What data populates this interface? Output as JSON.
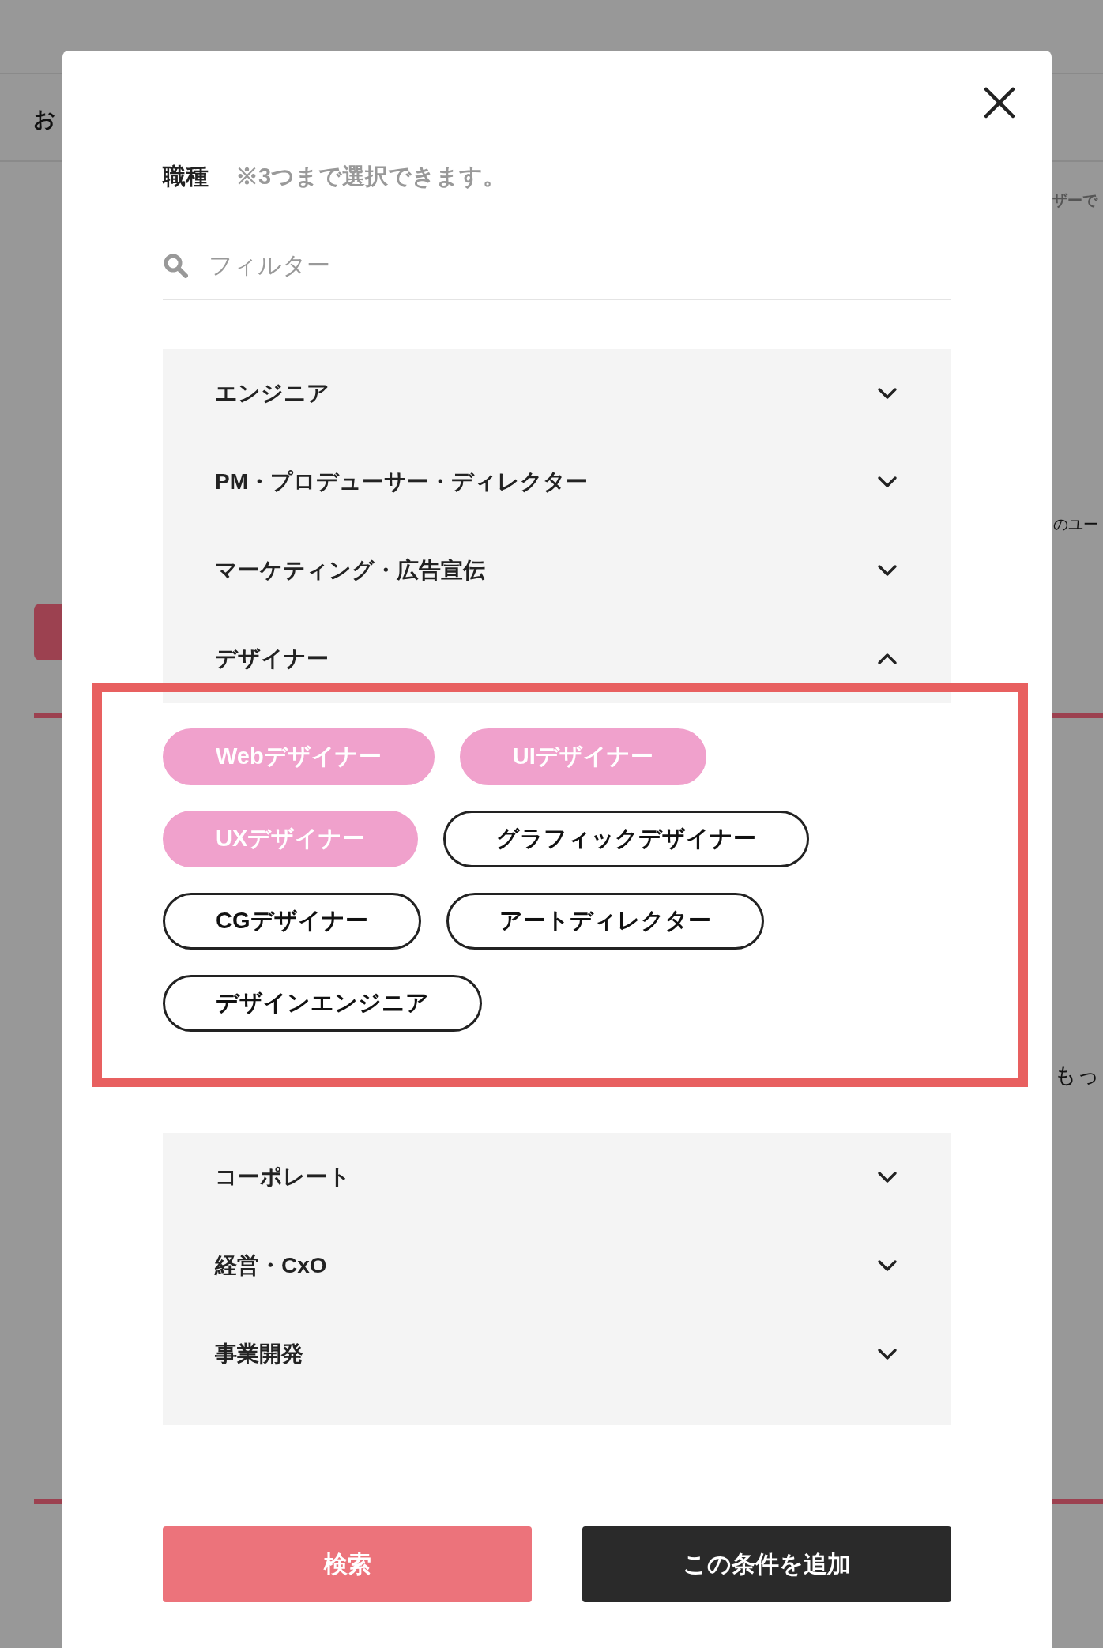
{
  "background": {
    "fragments": [
      "お",
      "ザーで",
      "のユー",
      "もっ"
    ]
  },
  "dialog": {
    "title": "職種",
    "note": "※3つまで選択できます。",
    "search": {
      "placeholder": "フィルター"
    },
    "sections": [
      {
        "label": "エンジニア",
        "expanded": false,
        "highlighted": false
      },
      {
        "label": "PM・プロデューサー・ディレクター",
        "expanded": false,
        "highlighted": false
      },
      {
        "label": "マーケティング・広告宣伝",
        "expanded": false,
        "highlighted": false
      },
      {
        "label": "デザイナー",
        "expanded": true,
        "highlighted": true,
        "options": [
          {
            "label": "Webデザイナー",
            "selected": true
          },
          {
            "label": "UIデザイナー",
            "selected": true
          },
          {
            "label": "UXデザイナー",
            "selected": true
          },
          {
            "label": "グラフィックデザイナー",
            "selected": false
          },
          {
            "label": "CGデザイナー",
            "selected": false
          },
          {
            "label": "アートディレクター",
            "selected": false
          },
          {
            "label": "デザインエンジニア",
            "selected": false
          }
        ]
      },
      {
        "label": "コーポレート",
        "expanded": false,
        "highlighted": false
      },
      {
        "label": "経営・CxO",
        "expanded": false,
        "highlighted": false
      },
      {
        "label": "事業開発",
        "expanded": false,
        "highlighted": false
      }
    ],
    "buttons": [
      {
        "kind": "primary",
        "label": "検索"
      },
      {
        "kind": "secondary",
        "label": "この条件を追加"
      }
    ]
  }
}
